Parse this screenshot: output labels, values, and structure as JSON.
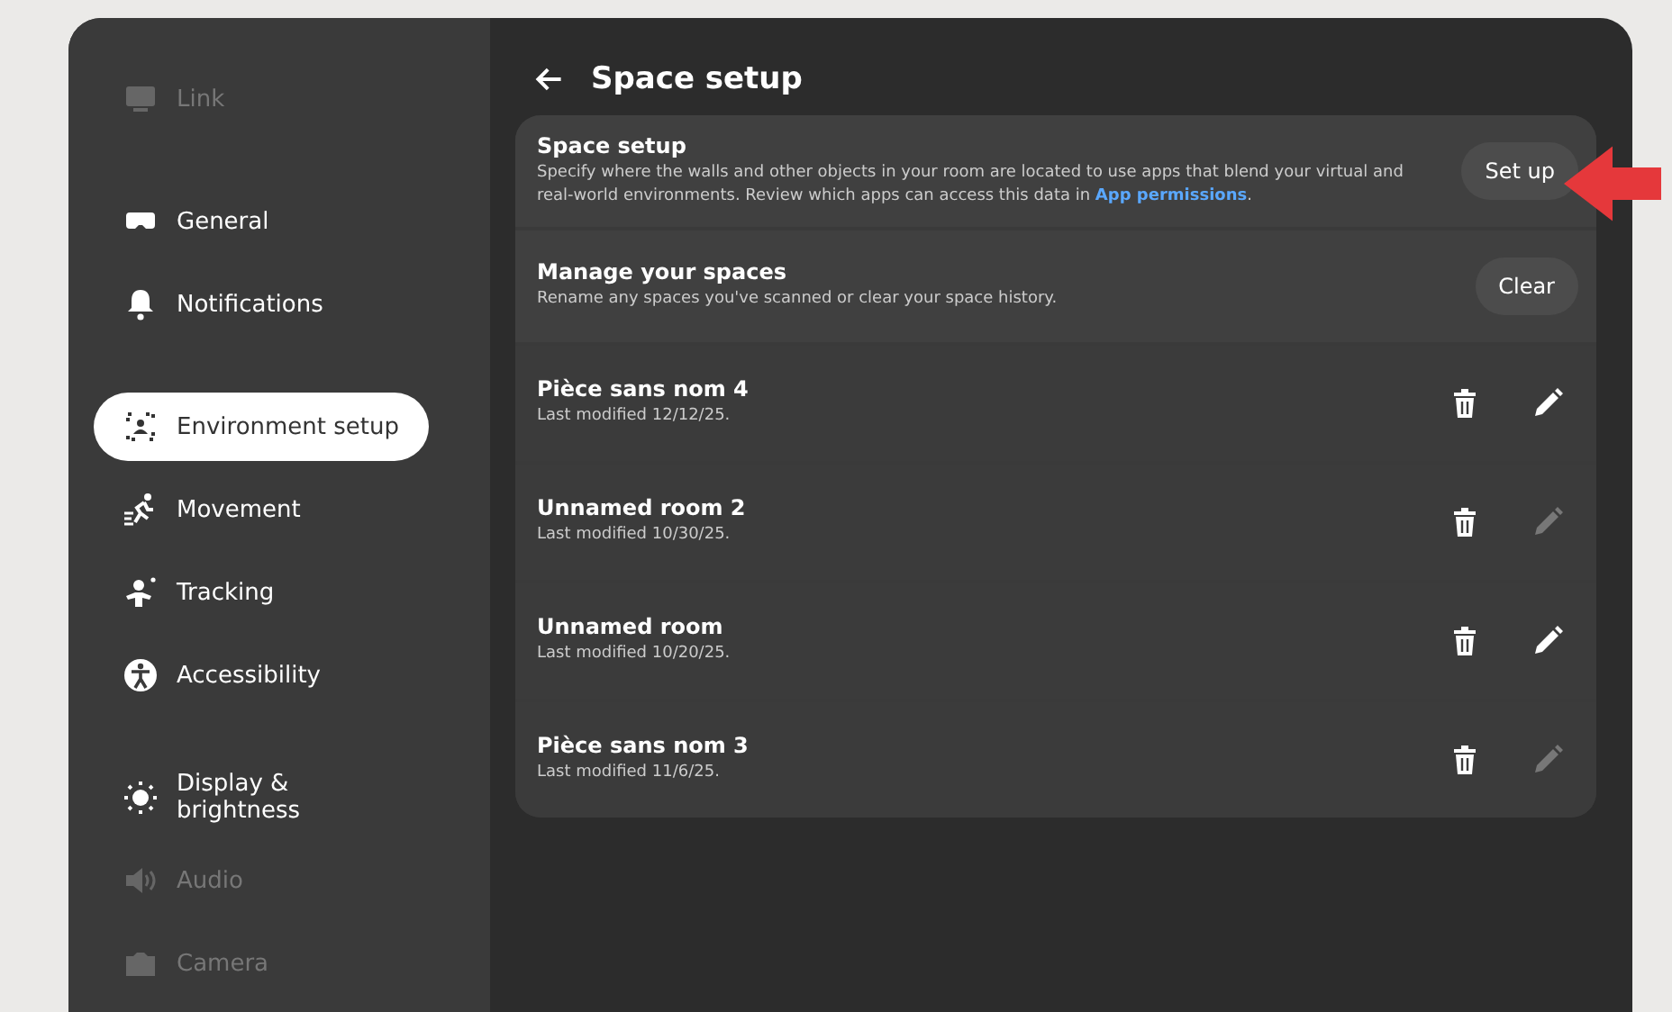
{
  "sidebar": {
    "sections": [
      {
        "items": [
          {
            "label": "Link",
            "selected": false,
            "faded": true
          }
        ]
      },
      {
        "items": [
          {
            "label": "General",
            "selected": false,
            "faded": false
          },
          {
            "label": "Notifications",
            "selected": false,
            "faded": false
          }
        ]
      },
      {
        "items": [
          {
            "label": "Environment setup",
            "selected": true,
            "faded": false
          },
          {
            "label": "Movement",
            "selected": false,
            "faded": false
          },
          {
            "label": "Tracking",
            "selected": false,
            "faded": false
          },
          {
            "label": "Accessibility",
            "selected": false,
            "faded": false
          }
        ]
      },
      {
        "items": [
          {
            "label": "Display & brightness",
            "selected": false,
            "faded": false
          },
          {
            "label": "Audio",
            "selected": false,
            "faded": true
          },
          {
            "label": "Camera",
            "selected": false,
            "faded": true
          }
        ]
      }
    ]
  },
  "page": {
    "title": "Space setup",
    "space_setup": {
      "title": "Space setup",
      "description": "Specify where the walls and other objects in your room are located to use apps that blend your virtual and real-world environments. Review which apps can access this data in ",
      "link": "App permissions",
      "after_link": ".",
      "button": "Set up"
    },
    "manage": {
      "title": "Manage your spaces",
      "description": "Rename any spaces you've scanned or clear your space history.",
      "button": "Clear"
    },
    "rooms": [
      {
        "name": "Pièce sans nom 4",
        "modified": "Last modified 12/12/25.",
        "edit_disabled": false
      },
      {
        "name": "Unnamed room 2",
        "modified": "Last modified 10/30/25.",
        "edit_disabled": true
      },
      {
        "name": "Unnamed room",
        "modified": "Last modified 10/20/25.",
        "edit_disabled": false
      },
      {
        "name": "Pièce sans nom 3",
        "modified": "Last modified 11/6/25.",
        "edit_disabled": true
      }
    ]
  }
}
